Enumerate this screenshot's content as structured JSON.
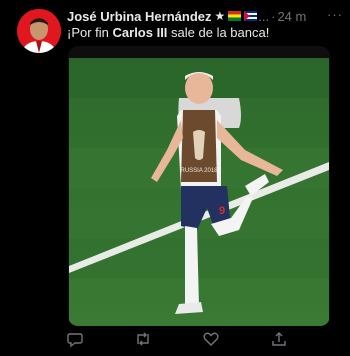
{
  "tweet": {
    "author_name": "José Urbina Hernández",
    "star": "★",
    "ellipsis": "...",
    "separator": "·",
    "time": "24 m",
    "more": "···",
    "text_before": "¡Por fin ",
    "text_bold": "Carlos III",
    "text_after": " sale de la banca!",
    "image_vest_text": "RUSSIA 2018",
    "image_number": "9"
  },
  "actions": [
    "reply-icon",
    "retweet-icon",
    "like-icon",
    "share-icon"
  ],
  "colors": {
    "background": "#000000",
    "text": "#e7e9ea",
    "muted": "#71767b",
    "avatar_bg": "#e1161f",
    "pitch": "#2f6b2f"
  }
}
